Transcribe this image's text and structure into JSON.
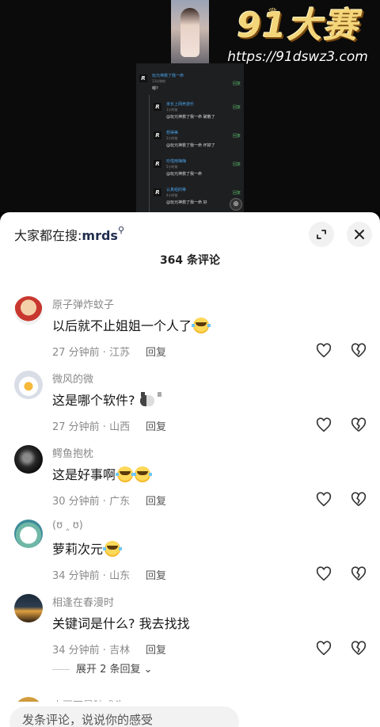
{
  "video": {
    "logo_text": "91大赛",
    "logo_url": "https://91dswz3.com",
    "mini_comments": [
      {
        "name": "玩元神救了我一命",
        "time": "13分钟前",
        "text": "嗯?",
        "reply": "回复"
      },
      {
        "name": "未长上网养游乐",
        "time": "1小时前",
        "text": "@玩元神救了我一命 破散了",
        "reply": "回复"
      },
      {
        "name": "想得美",
        "time": "2小时前",
        "text": "@玩元神救了我一命 坏掉了",
        "reply": "回复"
      },
      {
        "name": "珍惜用梅梅",
        "time": "5小时前",
        "text": "@玩元神救了我一命",
        "reply": "回复"
      },
      {
        "name": "认真组的等",
        "time": "4小时前",
        "text": "@玩元神救了我一命 好",
        "reply": "回复"
      }
    ]
  },
  "header": {
    "search_prefix": "大家都在搜:",
    "search_keyword": "mrds",
    "comment_count": "364 条评论"
  },
  "comments": [
    {
      "user": "原子弹炸蚊子",
      "text": "以后就不止姐姐一个人了",
      "location": "27 分钟前 · 江苏",
      "reply": "回复"
    },
    {
      "user": "微风的微",
      "text": "这是哪个软件?",
      "location": "27 分钟前 · 山西",
      "reply": "回复"
    },
    {
      "user": "鳄鱼抱枕",
      "text": "这是好事啊",
      "location": "30 分钟前 · 广东",
      "reply": "回复"
    },
    {
      "user": "(ʊ ‸ ʊ)",
      "text": "萝莉次元",
      "location": "34 分钟前 · 山东",
      "reply": "回复"
    },
    {
      "user": "相逢在春漫时",
      "text": "关键词是什么? 我去找找",
      "location": "34 分钟前 · 吉林",
      "reply": "回复"
    }
  ],
  "expand_replies": "展开 2 条回复",
  "next_comment_user": "小豆丁是破戒头",
  "composer": {
    "placeholder": "发条评论，说说你的感受"
  },
  "colors": {
    "keyword": "#1f2d4d",
    "logo_gold": "#f3d57a",
    "mini_link": "#4aa3e8"
  }
}
